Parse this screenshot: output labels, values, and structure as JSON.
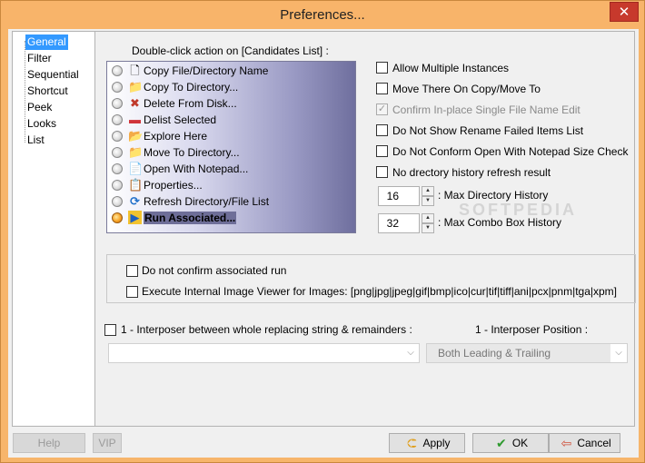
{
  "window": {
    "title": "Preferences...",
    "close_glyph": "✕"
  },
  "nav": {
    "items": [
      {
        "label": "General",
        "selected": true
      },
      {
        "label": "Filter"
      },
      {
        "label": "Sequential"
      },
      {
        "label": "Shortcut"
      },
      {
        "label": "Peek"
      },
      {
        "label": "Looks"
      },
      {
        "label": "List"
      }
    ]
  },
  "general": {
    "double_click_label": "Double-click action on [Candidates List] :",
    "actions": [
      {
        "label": "Copy File/Directory Name",
        "icon": "document-copy-icon",
        "glyph": "🗋"
      },
      {
        "label": "Copy To Directory...",
        "icon": "folder-copy-icon",
        "glyph": "📁"
      },
      {
        "label": "Delete From Disk...",
        "icon": "delete-x-icon",
        "glyph": "✖"
      },
      {
        "label": "Delist Selected",
        "icon": "delist-bar-icon",
        "glyph": "▬"
      },
      {
        "label": "Explore Here",
        "icon": "explore-folder-icon",
        "glyph": "📂"
      },
      {
        "label": "Move To Directory...",
        "icon": "folder-move-icon",
        "glyph": "📁"
      },
      {
        "label": "Open With Notepad...",
        "icon": "notepad-icon",
        "glyph": "📄"
      },
      {
        "label": "Properties...",
        "icon": "properties-icon",
        "glyph": "📋"
      },
      {
        "label": "Refresh Directory/File List",
        "icon": "refresh-icon",
        "glyph": "⟳"
      },
      {
        "label": "Run Associated...",
        "icon": "run-associated-icon",
        "glyph": "▶",
        "selected": true
      }
    ],
    "options": [
      {
        "label": "Allow Multiple Instances",
        "checked": false,
        "disabled": false
      },
      {
        "label": "Move There On Copy/Move To",
        "checked": false,
        "disabled": false
      },
      {
        "label": "Confirm In-place Single File Name Edit",
        "checked": true,
        "disabled": true
      },
      {
        "label": "Do Not Show Rename Failed Items List",
        "checked": false,
        "disabled": false
      },
      {
        "label": "Do Not Conform Open With Notepad Size Check",
        "checked": false,
        "disabled": false
      },
      {
        "label": "No drectory history refresh result",
        "checked": false,
        "disabled": false
      }
    ],
    "max_directory_history": {
      "value": "16",
      "label": ": Max Directory History"
    },
    "max_combo_box_history": {
      "value": "32",
      "label": ": Max Combo Box History"
    },
    "watermark": "SOFTPEDIA",
    "associated": {
      "no_confirm_label": "Do not confirm associated run",
      "internal_viewer_label": "Execute Internal Image Viewer for Images: [png|jpg|jpeg|gif|bmp|ico|cur|tif|tiff|ani|pcx|pnm|tga|xpm]"
    },
    "interposer": {
      "checkbox_label": "1 - Interposer between whole replacing string & remainders :",
      "position_label": "1 - Interposer Position :",
      "string_value": "",
      "position_value": "Both Leading & Trailing"
    }
  },
  "buttons": {
    "help": "Help",
    "vip": "VIP",
    "apply": "Apply",
    "ok": "OK",
    "cancel": "Cancel"
  },
  "colors": {
    "titlebar": "#f8b46a",
    "close": "#c7392c",
    "nav_selected": "#3399ff"
  }
}
